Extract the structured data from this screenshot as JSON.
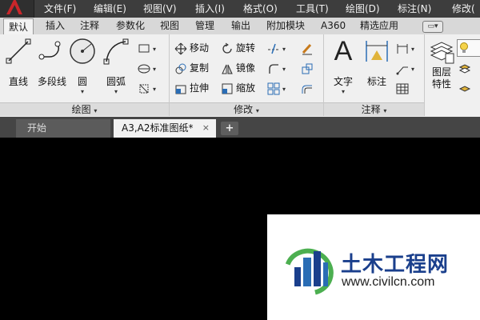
{
  "menubar": {
    "items": [
      "文件(F)",
      "编辑(E)",
      "视图(V)",
      "插入(I)",
      "格式(O)",
      "工具(T)",
      "绘图(D)",
      "标注(N)",
      "修改("
    ]
  },
  "ribbon_tabs": [
    "默认",
    "插入",
    "注释",
    "参数化",
    "视图",
    "管理",
    "输出",
    "附加模块",
    "A360",
    "精选应用"
  ],
  "panels": {
    "draw": {
      "title": "绘图",
      "line": "直线",
      "polyline": "多段线",
      "circle": "圆",
      "arc": "圆弧"
    },
    "modify": {
      "title": "修改",
      "move": "移动",
      "rotate": "旋转",
      "copy": "复制",
      "mirror": "镜像",
      "stretch": "拉伸",
      "scale": "缩放"
    },
    "annotation": {
      "title": "注释",
      "text": "文字",
      "dimension": "标注"
    },
    "layers": {
      "properties_line1": "图层",
      "properties_line2": "特性"
    }
  },
  "file_tabs": {
    "start": "开始",
    "document": "A3,A2标准图纸*",
    "close": "×",
    "new": "+"
  },
  "watermark": {
    "title": "土木工程网",
    "url": "www.civilcn.com"
  },
  "colors": {
    "menubar": "#3d3d3d",
    "ribbon": "#f0f0f0",
    "canvas": "#000000",
    "watermark_blue": "#1a3f8c",
    "watermark_green": "#4caf50"
  }
}
